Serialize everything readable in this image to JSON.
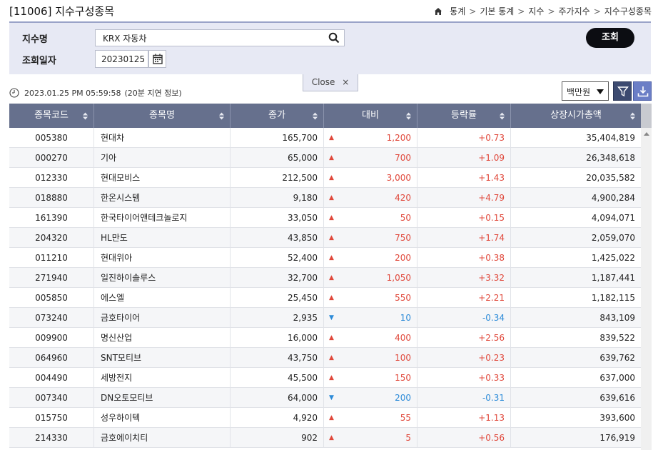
{
  "header": {
    "title": "[11006] 지수구성종목",
    "breadcrumb": [
      "통계",
      "기본 통계",
      "지수",
      "주가지수",
      "지수구성종목"
    ]
  },
  "search": {
    "index_label": "지수명",
    "index_value": "KRX 자동차",
    "date_label": "조회일자",
    "date_value": "20230125",
    "query_button": "조회"
  },
  "close_tab": {
    "label": "Close",
    "icon": "×"
  },
  "info": {
    "timestamp": "2023.01.25 PM 05:59:58",
    "delay_note": "(20분 지연 정보)",
    "unit": "백만원"
  },
  "table": {
    "columns": [
      "종목코드",
      "종목명",
      "종가",
      "대비",
      "등락률",
      "상장시가총액"
    ],
    "rows": [
      {
        "code": "005380",
        "name": "현대차",
        "close": "165,700",
        "dir": "up",
        "change": "1,200",
        "rate": "+0.73",
        "cap": "35,404,819"
      },
      {
        "code": "000270",
        "name": "기아",
        "close": "65,000",
        "dir": "up",
        "change": "700",
        "rate": "+1.09",
        "cap": "26,348,618"
      },
      {
        "code": "012330",
        "name": "현대모비스",
        "close": "212,500",
        "dir": "up",
        "change": "3,000",
        "rate": "+1.43",
        "cap": "20,035,582"
      },
      {
        "code": "018880",
        "name": "한온시스템",
        "close": "9,180",
        "dir": "up",
        "change": "420",
        "rate": "+4.79",
        "cap": "4,900,284"
      },
      {
        "code": "161390",
        "name": "한국타이어앤테크놀로지",
        "close": "33,050",
        "dir": "up",
        "change": "50",
        "rate": "+0.15",
        "cap": "4,094,071"
      },
      {
        "code": "204320",
        "name": "HL만도",
        "close": "43,850",
        "dir": "up",
        "change": "750",
        "rate": "+1.74",
        "cap": "2,059,070"
      },
      {
        "code": "011210",
        "name": "현대위아",
        "close": "52,400",
        "dir": "up",
        "change": "200",
        "rate": "+0.38",
        "cap": "1,425,022"
      },
      {
        "code": "271940",
        "name": "일진하이솔루스",
        "close": "32,700",
        "dir": "up",
        "change": "1,050",
        "rate": "+3.32",
        "cap": "1,187,441"
      },
      {
        "code": "005850",
        "name": "에스엘",
        "close": "25,450",
        "dir": "up",
        "change": "550",
        "rate": "+2.21",
        "cap": "1,182,115"
      },
      {
        "code": "073240",
        "name": "금호타이어",
        "close": "2,935",
        "dir": "down",
        "change": "10",
        "rate": "-0.34",
        "cap": "843,109"
      },
      {
        "code": "009900",
        "name": "명신산업",
        "close": "16,000",
        "dir": "up",
        "change": "400",
        "rate": "+2.56",
        "cap": "839,522"
      },
      {
        "code": "064960",
        "name": "SNT모티브",
        "close": "43,750",
        "dir": "up",
        "change": "100",
        "rate": "+0.23",
        "cap": "639,762"
      },
      {
        "code": "004490",
        "name": "세방전지",
        "close": "45,500",
        "dir": "up",
        "change": "150",
        "rate": "+0.33",
        "cap": "637,000"
      },
      {
        "code": "007340",
        "name": "DN오토모티브",
        "close": "64,000",
        "dir": "down",
        "change": "200",
        "rate": "-0.31",
        "cap": "639,616"
      },
      {
        "code": "015750",
        "name": "성우하이텍",
        "close": "4,920",
        "dir": "up",
        "change": "55",
        "rate": "+1.13",
        "cap": "393,600"
      },
      {
        "code": "214330",
        "name": "금호에이치티",
        "close": "902",
        "dir": "up",
        "change": "5",
        "rate": "+0.56",
        "cap": "176,919"
      }
    ]
  },
  "colors": {
    "up": "#e0473a",
    "down": "#2b8ad8",
    "header_bg": "#66708d",
    "panel_bg": "#e7e9f4"
  },
  "icons": {
    "home": "home-icon",
    "search": "search-icon",
    "calendar": "calendar-icon",
    "clock": "clock-icon",
    "filter": "filter-icon",
    "download": "download-icon",
    "sort": "sort-icon",
    "up_arrow": "▲",
    "down_arrow": "▼"
  }
}
